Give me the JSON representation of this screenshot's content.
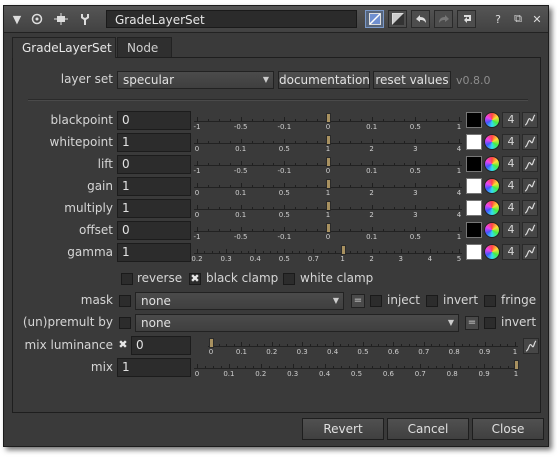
{
  "window": {
    "title": "GradeLayerSet"
  },
  "tabs": [
    {
      "label": "GradeLayerSet"
    },
    {
      "label": "Node"
    }
  ],
  "layerset": {
    "label": "layer set",
    "value": "specular",
    "documentation_label": "documentation",
    "reset_label": "reset values",
    "version": "v0.8.0"
  },
  "knobs": [
    {
      "label": "blackpoint",
      "value": "0",
      "swatch": "#000000",
      "count": "4",
      "level": 0,
      "ticks": [
        "-1",
        "-0.5",
        "-0.1",
        "0",
        "0.1",
        "0.5",
        "1"
      ]
    },
    {
      "label": "whitepoint",
      "value": "1",
      "swatch": "#ffffff",
      "count": "4",
      "level": 1,
      "ticks": [
        "0",
        "0.1",
        "0.5",
        "1",
        "2",
        "3",
        "4"
      ]
    },
    {
      "label": "lift",
      "value": "0",
      "swatch": "#000000",
      "count": "4",
      "level": 0,
      "ticks": [
        "-1",
        "-0.5",
        "-0.1",
        "0",
        "0.1",
        "0.5",
        "1"
      ]
    },
    {
      "label": "gain",
      "value": "1",
      "swatch": "#ffffff",
      "count": "4",
      "level": 1,
      "ticks": [
        "0",
        "0.1",
        "0.5",
        "1",
        "2",
        "3",
        "4"
      ]
    },
    {
      "label": "multiply",
      "value": "1",
      "swatch": "#ffffff",
      "count": "4",
      "level": 1,
      "ticks": [
        "0",
        "0.1",
        "0.5",
        "1",
        "2",
        "3",
        "4"
      ]
    },
    {
      "label": "offset",
      "value": "0",
      "swatch": "#000000",
      "count": "4",
      "level": 0,
      "ticks": [
        "-1",
        "-0.5",
        "-0.1",
        "0",
        "0.1",
        "0.5",
        "1"
      ]
    },
    {
      "label": "gamma",
      "value": "1",
      "swatch": "#ffffff",
      "count": "4",
      "level": 1,
      "ticks": [
        "0.2",
        "0.3",
        "0.4",
        "0.5",
        "0.7",
        "1",
        "2",
        "3",
        "4",
        "5"
      ]
    }
  ],
  "clamps": {
    "reverse": {
      "label": "reverse",
      "checked": false
    },
    "black": {
      "label": "black clamp",
      "checked": true,
      "mark": "✖"
    },
    "white": {
      "label": "white clamp",
      "checked": false
    }
  },
  "mask": {
    "label": "mask",
    "value": "none",
    "eq": "=",
    "inject": "inject",
    "invert": "invert",
    "fringe": "fringe"
  },
  "premult": {
    "label": "(un)premult by",
    "value": "none",
    "eq": "=",
    "invert": "invert"
  },
  "mixlum": {
    "label": "mix luminance",
    "value": "0",
    "mark": "✖",
    "level": 0,
    "ticks": [
      "0",
      "0.1",
      "0.2",
      "0.3",
      "0.4",
      "0.5",
      "0.6",
      "0.7",
      "0.8",
      "0.9",
      "1"
    ]
  },
  "mix": {
    "label": "mix",
    "value": "1",
    "level": 1,
    "ticks": [
      "0",
      "0.1",
      "0.2",
      "0.3",
      "0.4",
      "0.5",
      "0.6",
      "0.7",
      "0.8",
      "0.9",
      "1"
    ]
  },
  "footer": {
    "revert": "Revert",
    "cancel": "Cancel",
    "close": "Close"
  },
  "titlebar_icons": {
    "help": "?",
    "float": "⧉",
    "close": "✕"
  }
}
